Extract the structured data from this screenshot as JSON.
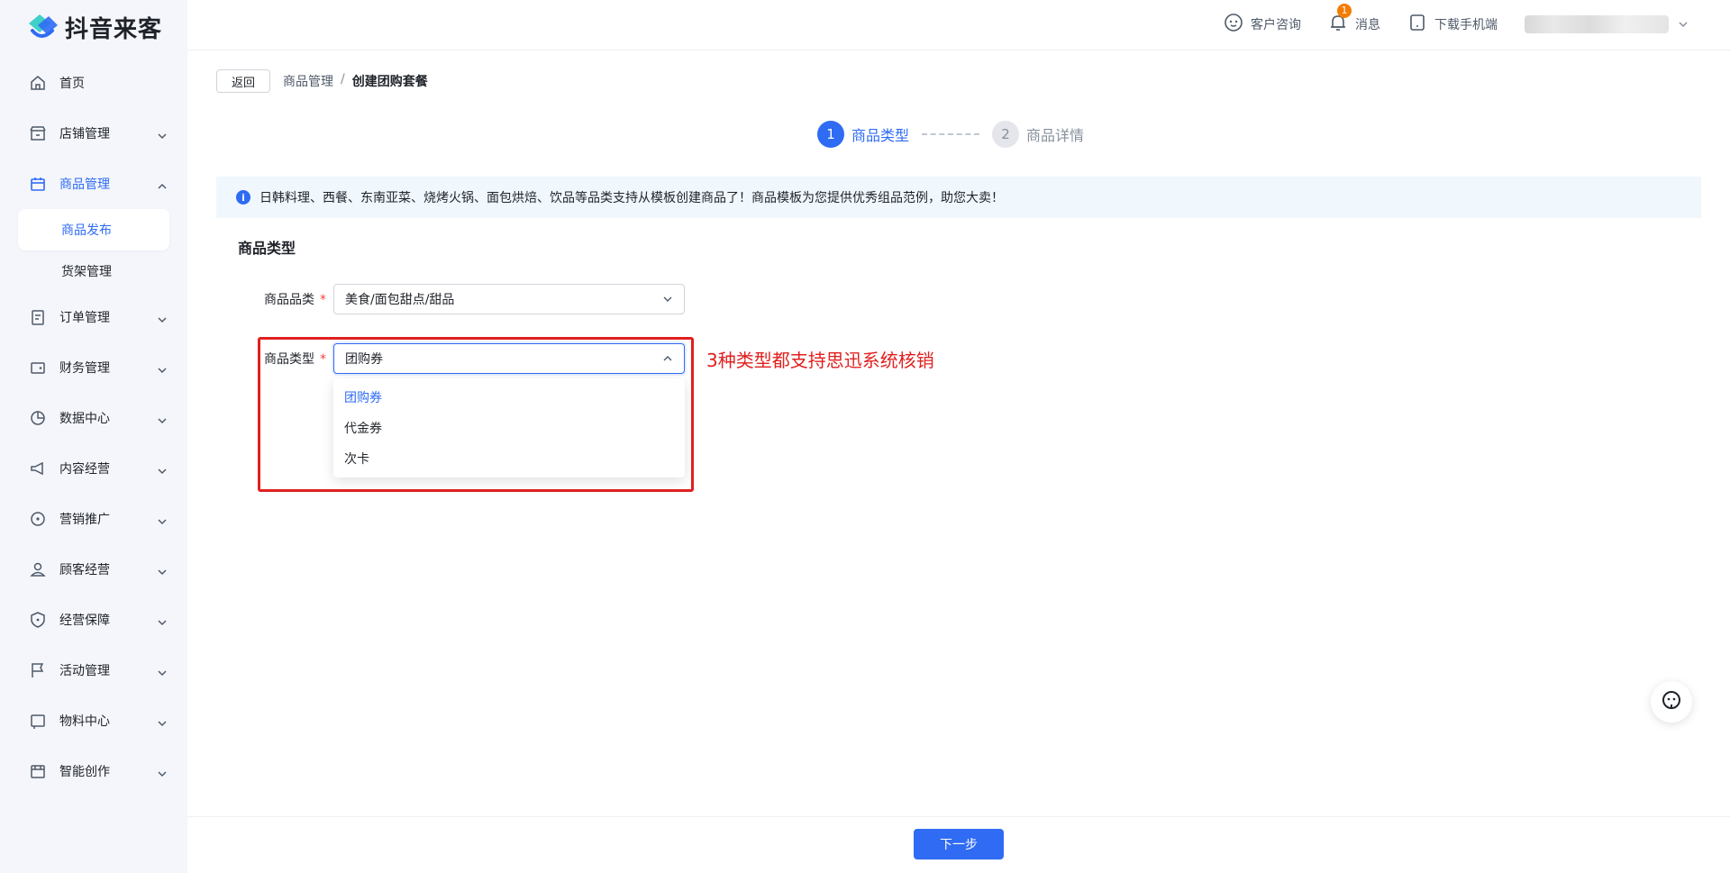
{
  "app": {
    "logo_text": "抖音来客"
  },
  "colors": {
    "accent": "#2f6bf3",
    "annotation": "#e02020",
    "banner_bg": "#f0f7fd"
  },
  "topbar": {
    "customer_service": "客户咨询",
    "messages": "消息",
    "message_badge": "1",
    "download_app": "下载手机端"
  },
  "sidebar": {
    "items": [
      {
        "label": "首页",
        "icon": "home-icon"
      },
      {
        "label": "店铺管理",
        "icon": "store-icon"
      },
      {
        "label": "商品管理",
        "icon": "product-icon",
        "expanded": true
      },
      {
        "label": "订单管理",
        "icon": "order-icon"
      },
      {
        "label": "财务管理",
        "icon": "wallet-icon"
      },
      {
        "label": "数据中心",
        "icon": "pie-chart-icon"
      },
      {
        "label": "内容经营",
        "icon": "megaphone-icon"
      },
      {
        "label": "营销推广",
        "icon": "location-icon"
      },
      {
        "label": "顾客经营",
        "icon": "user-icon"
      },
      {
        "label": "经营保障",
        "icon": "shield-icon"
      },
      {
        "label": "活动管理",
        "icon": "flag-icon"
      },
      {
        "label": "物料中心",
        "icon": "material-icon"
      },
      {
        "label": "智能创作",
        "icon": "film-icon"
      }
    ],
    "sub_items": [
      {
        "label": "商品发布",
        "selected": true
      },
      {
        "label": "货架管理",
        "selected": false
      }
    ]
  },
  "breadcrumb": {
    "back": "返回",
    "parent": "商品管理",
    "separator": "/",
    "current": "创建团购套餐"
  },
  "steps": [
    {
      "num": "1",
      "label": "商品类型",
      "active": true
    },
    {
      "num": "2",
      "label": "商品详情",
      "active": false
    }
  ],
  "banner": {
    "text": "日韩料理、西餐、东南亚菜、烧烤火锅、面包烘焙、饮品等品类支持从模板创建商品了！商品模板为您提供优秀组品范例，助您大卖！"
  },
  "section": {
    "title": "商品类型"
  },
  "form": {
    "category": {
      "label": "商品品类",
      "required_mark": "*",
      "value": "美食/面包甜点/甜品"
    },
    "type": {
      "label": "商品类型",
      "required_mark": "*",
      "value": "团购券",
      "options": [
        "团购券",
        "代金券",
        "次卡"
      ]
    }
  },
  "annotation": {
    "text": "3种类型都支持思迅系统核销"
  },
  "footer": {
    "next": "下一步"
  }
}
